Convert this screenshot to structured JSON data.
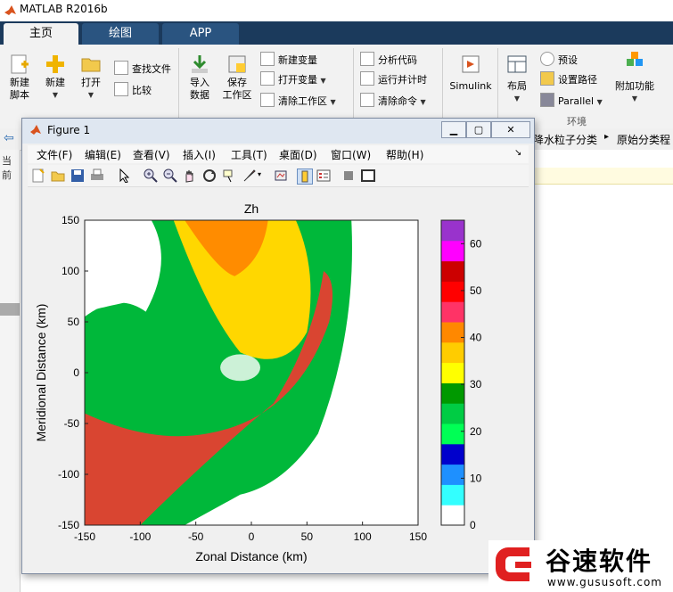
{
  "app": {
    "title": "MATLAB R2016b"
  },
  "tabs": [
    {
      "label": "主页"
    },
    {
      "label": "绘图"
    },
    {
      "label": "APP"
    }
  ],
  "ribbon": {
    "new_script": "新建\n脚本",
    "new": "新建",
    "open": "打开",
    "find_files": "查找文件",
    "compare": "比较",
    "import": "导入\n数据",
    "save_ws": "保存\n工作区",
    "new_var": "新建变量",
    "open_var": "打开变量",
    "clear_ws": "清除工作区",
    "analyze": "分析代码",
    "run_time": "运行并计时",
    "clear_cmd": "清除命令",
    "simulink": "Simulink",
    "layout": "布局",
    "prefs": "预设",
    "set_path": "设置路径",
    "parallel": "Parallel",
    "addons": "附加功能",
    "env_group": "环境"
  },
  "breadcrumb": {
    "items": [
      "降水粒子分类",
      "原始分类程"
    ],
    "sep": "▸",
    "current_label": "当前"
  },
  "figure": {
    "title": "Figure 1",
    "menus": [
      "文件(F)",
      "编辑(E)",
      "查看(V)",
      "插入(I)",
      "工具(T)",
      "桌面(D)",
      "窗口(W)",
      "帮助(H)"
    ]
  },
  "chart_data": {
    "type": "heatmap",
    "title": "Zh",
    "xlabel": "Zonal Distance (km)",
    "ylabel": "Meridional Distance (km)",
    "xlim": [
      -150,
      150
    ],
    "ylim": [
      -150,
      150
    ],
    "xticks": [
      "-150",
      "-100",
      "-50",
      "0",
      "50",
      "100",
      "150"
    ],
    "yticks": [
      "150",
      "100",
      "50",
      "0",
      "-50",
      "-100",
      "-150"
    ],
    "colorbar": {
      "ticks": [
        "60",
        "50",
        "40",
        "30",
        "20",
        "10",
        "0"
      ],
      "range": [
        0,
        65
      ],
      "colors": [
        "#ffffff",
        "#33ffff",
        "#1e90ff",
        "#0000cc",
        "#00ff55",
        "#00cc44",
        "#009900",
        "#ffff00",
        "#ffcc00",
        "#ff8800",
        "#ff3366",
        "#ff0000",
        "#cc0000",
        "#ff00ff",
        "#9933cc"
      ]
    }
  },
  "watermark": {
    "brand": "谷速软件",
    "url": "www.gususoft.com"
  }
}
